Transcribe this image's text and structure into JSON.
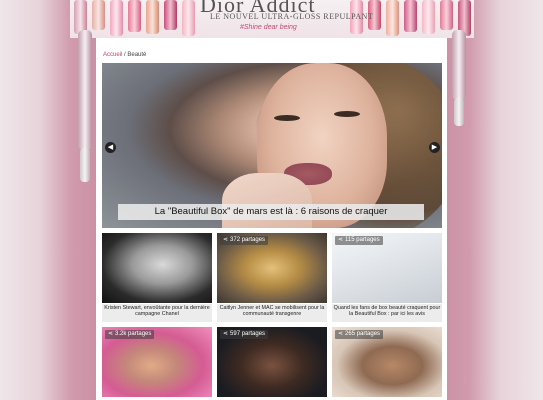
{
  "banner": {
    "title": "Dior Addict",
    "subtitle": "LE NOUVEL ULTRA-GLOSS REPULPANT",
    "tagline": "#Shine dear being"
  },
  "breadcrumb": {
    "home": "Accueil",
    "separator": " / ",
    "current": "Beauté"
  },
  "hero": {
    "caption": "La \"Beautiful Box\" de mars est là : 6 raisons de craquer",
    "prev_icon": "◀",
    "next_icon": "▶"
  },
  "cards": [
    {
      "shares": "",
      "caption": "Kristen Stewart, envoûtante pour la dernière campagne Chanel"
    },
    {
      "shares": "372 partages",
      "caption": "Caitlyn Jenner et MAC se mobilisent pour la communauté transgenre"
    },
    {
      "shares": "115 partages",
      "caption": "Quand les fans de box beauté craquent pour la Beautiful Box : par ici les avis"
    },
    {
      "shares": "3.2k partages",
      "caption": ""
    },
    {
      "shares": "597 partages",
      "caption": ""
    },
    {
      "shares": "265 partages",
      "caption": ""
    }
  ],
  "colors": {
    "accent": "#c33d7b",
    "page_bg": "#d19cad"
  }
}
